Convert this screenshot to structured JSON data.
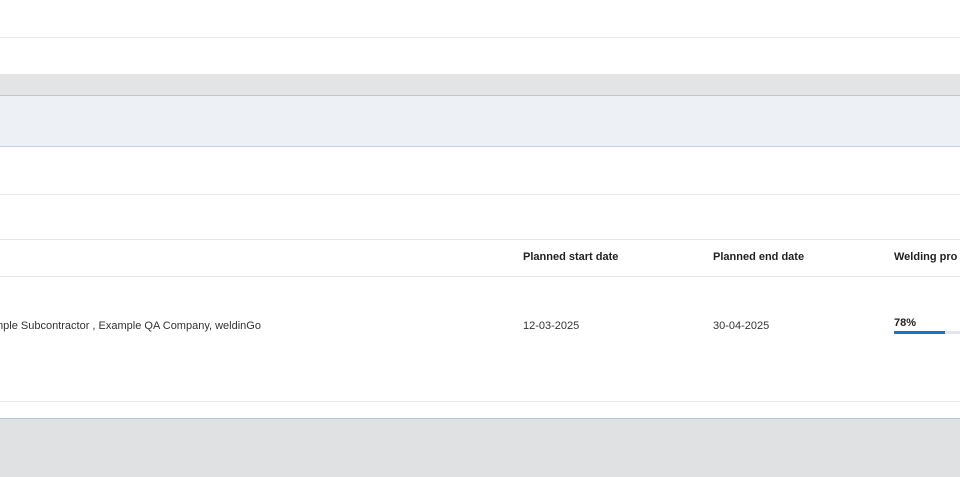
{
  "table": {
    "headers": {
      "companies": "",
      "planned_start_date": "Planned start date",
      "planned_end_date": "Planned end date",
      "welding_progress": "Welding pro"
    },
    "row": {
      "companies": "mple Subcontractor , Example QA Company, weldinGo",
      "planned_start_date": "12-03-2025",
      "planned_end_date": "30-04-2025",
      "welding_progress_label": "78%",
      "welding_progress_value": 0.78
    }
  },
  "colors": {
    "progress_fill": "#1a73c8",
    "progress_track": "#dfe6ee",
    "band_gray": "#e2e4e6",
    "row_shade": "#edf1f5"
  }
}
